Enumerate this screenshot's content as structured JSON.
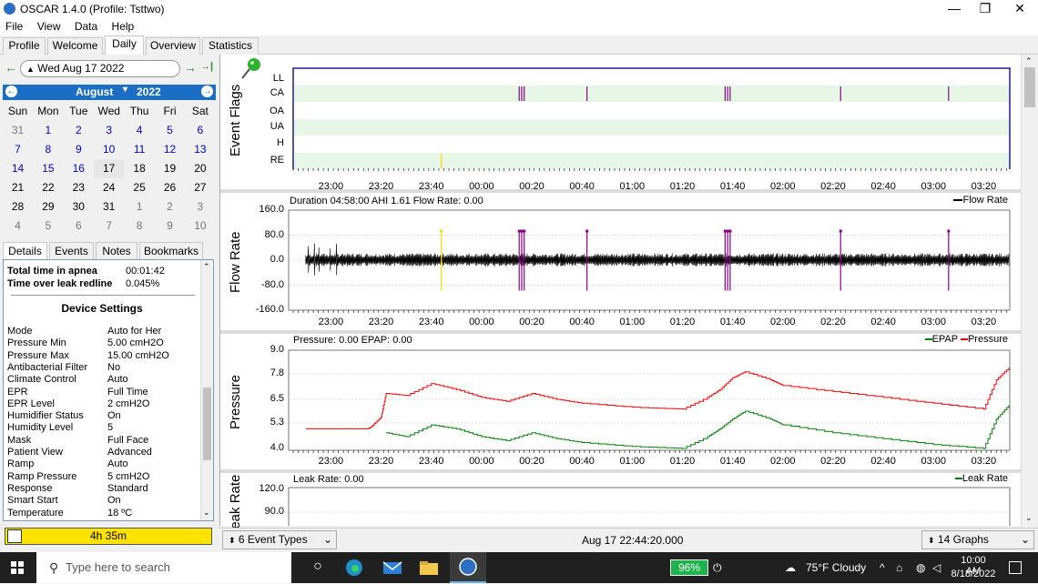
{
  "window": {
    "title": "OSCAR 1.4.0 (Profile: Tsttwo)",
    "minimize": "—",
    "maximize": "❐",
    "close": "✕"
  },
  "menu": [
    "File",
    "View",
    "Data",
    "Help"
  ],
  "tabs": [
    "Profile",
    "Welcome",
    "Daily",
    "Overview",
    "Statistics"
  ],
  "active_tab": "Daily",
  "date_nav": {
    "date": "Wed Aug 17 2022",
    "back": "←",
    "forward": "→",
    "last": "→|"
  },
  "calendar": {
    "month": "August",
    "year": "2022",
    "weekdays": [
      "Sun",
      "Mon",
      "Tue",
      "Wed",
      "Thu",
      "Fri",
      "Sat"
    ],
    "weeks": [
      [
        "31",
        "1",
        "2",
        "3",
        "4",
        "5",
        "6"
      ],
      [
        "7",
        "8",
        "9",
        "10",
        "11",
        "12",
        "13"
      ],
      [
        "14",
        "15",
        "16",
        "17",
        "18",
        "19",
        "20"
      ],
      [
        "21",
        "22",
        "23",
        "24",
        "25",
        "26",
        "27"
      ],
      [
        "28",
        "29",
        "30",
        "31",
        "1",
        "2",
        "3"
      ],
      [
        "4",
        "5",
        "6",
        "7",
        "8",
        "9",
        "10"
      ]
    ],
    "selected_day": "17"
  },
  "lower_tabs": [
    "Details",
    "Events",
    "Notes",
    "Bookmarks"
  ],
  "details": {
    "summary": [
      {
        "label": "Total time in apnea",
        "value": "00:01:42"
      },
      {
        "label": "Time over leak redline",
        "value": "0.045%"
      }
    ],
    "settings_title": "Device Settings",
    "settings": [
      {
        "label": "Mode",
        "value": "Auto for Her"
      },
      {
        "label": "Pressure Min",
        "value": "5.00 cmH2O"
      },
      {
        "label": "Pressure Max",
        "value": "15.00 cmH2O"
      },
      {
        "label": "Antibacterial Filter",
        "value": "No"
      },
      {
        "label": "Climate Control",
        "value": "Auto"
      },
      {
        "label": "EPR",
        "value": "Full Time"
      },
      {
        "label": "EPR Level",
        "value": "2 cmH2O"
      },
      {
        "label": "Humidifier Status",
        "value": "On"
      },
      {
        "label": "Humidity Level",
        "value": "5"
      },
      {
        "label": "Mask",
        "value": "Full Face"
      },
      {
        "label": "Patient View",
        "value": "Advanced"
      },
      {
        "label": "Ramp",
        "value": "Auto"
      },
      {
        "label": "Ramp Pressure",
        "value": "5 cmH2O"
      },
      {
        "label": "Response",
        "value": "Standard"
      },
      {
        "label": "Smart Start",
        "value": "On"
      },
      {
        "label": "Temperature",
        "value": "18 ºC"
      }
    ]
  },
  "session_duration": "4h 35m",
  "time_ticks": [
    "23:00",
    "23:20",
    "23:40",
    "00:00",
    "00:20",
    "00:40",
    "01:00",
    "01:20",
    "01:40",
    "02:00",
    "02:20",
    "02:40",
    "03:00",
    "03:20"
  ],
  "event_flags": {
    "ylabel": "Event Flags",
    "rows": [
      "LL",
      "CA",
      "OA",
      "UA",
      "H",
      "RE"
    ],
    "events": [
      {
        "type": "CA",
        "time": "00:15"
      },
      {
        "type": "CA",
        "time": "00:16"
      },
      {
        "type": "CA",
        "time": "00:17"
      },
      {
        "type": "CA",
        "time": "00:42"
      },
      {
        "type": "CA",
        "time": "01:37"
      },
      {
        "type": "CA",
        "time": "01:38"
      },
      {
        "type": "CA",
        "time": "01:39"
      },
      {
        "type": "CA",
        "time": "02:23"
      },
      {
        "type": "CA",
        "time": "03:06"
      },
      {
        "type": "RE",
        "time": "23:44"
      }
    ]
  },
  "flow_rate": {
    "ylabel": "Flow Rate",
    "title": "Duration 04:58:00 AHI 1.61 Flow Rate: 0.00",
    "legend": "Flow Rate",
    "yticks": [
      "160.0",
      "80.0",
      "0.0",
      "-80.0",
      "-160.0"
    ]
  },
  "pressure": {
    "ylabel": "Pressure",
    "title": "Pressure: 0.00 EPAP: 0.00",
    "legend_epap": "EPAP",
    "legend_pressure": "Pressure",
    "yticks": [
      "9.0",
      "7.8",
      "6.5",
      "5.3",
      "4.0"
    ]
  },
  "leak": {
    "ylabel": "Leak Rate",
    "title": "Leak Rate: 0.00",
    "legend": "Leak Rate",
    "yticks": [
      "120.0",
      "90.0"
    ]
  },
  "chart_data": [
    {
      "type": "line",
      "title": "Pressure: 0.00 EPAP: 0.00",
      "ylabel": "Pressure",
      "ylim": [
        4.0,
        9.0
      ],
      "x": [
        "22:50",
        "23:15",
        "23:16",
        "23:20",
        "23:22",
        "23:30",
        "23:40",
        "23:50",
        "00:00",
        "00:10",
        "00:20",
        "00:30",
        "00:40",
        "01:00",
        "01:20",
        "01:30",
        "01:35",
        "01:40",
        "01:45",
        "01:55",
        "02:00",
        "02:20",
        "02:40",
        "03:00",
        "03:20",
        "03:25",
        "03:30"
      ],
      "series": [
        {
          "name": "Pressure",
          "values": [
            5.0,
            5.0,
            5.1,
            5.6,
            6.8,
            6.7,
            7.3,
            7.0,
            6.6,
            6.4,
            6.8,
            6.5,
            6.3,
            6.1,
            6.0,
            6.6,
            7.0,
            7.6,
            7.9,
            7.5,
            7.2,
            6.9,
            6.6,
            6.3,
            6.0,
            7.5,
            8.1
          ]
        },
        {
          "name": "EPAP",
          "values": [
            null,
            null,
            null,
            null,
            4.8,
            4.6,
            5.2,
            5.0,
            4.6,
            4.4,
            4.8,
            4.5,
            4.3,
            4.1,
            4.0,
            4.6,
            5.0,
            5.5,
            5.9,
            5.5,
            5.2,
            4.8,
            4.5,
            4.2,
            4.0,
            5.5,
            6.2
          ]
        }
      ]
    }
  ],
  "bottom": {
    "event_types": "6 Event Types",
    "cursor_time": "Aug 17 22:44:20.000",
    "graphs": "14 Graphs"
  },
  "taskbar": {
    "search_placeholder": "Type here to search",
    "battery": "96%",
    "weather": "75°F Cloudy",
    "time": "10:00 AM",
    "date": "8/18/2022"
  },
  "colors": {
    "accent": "#1a6fc4",
    "flag_band": "#e6f7e6",
    "ca_flag": "#8b008b",
    "re_flag": "#ffd700",
    "pressure": "#ff0000",
    "epap": "#008000",
    "selection": "#ffe300"
  }
}
